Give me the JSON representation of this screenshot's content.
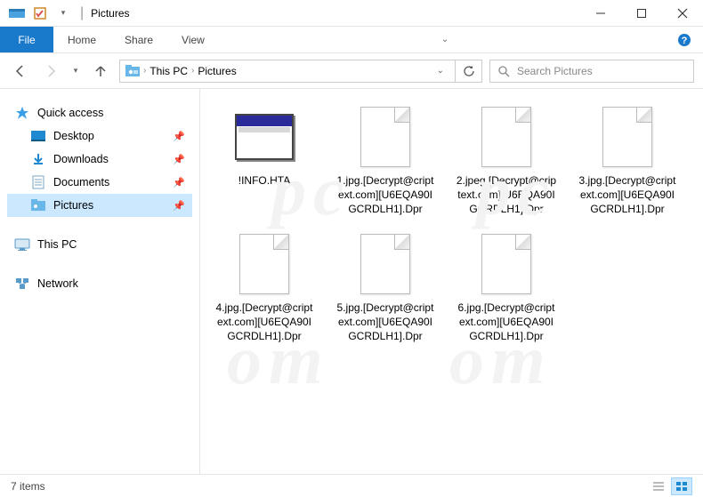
{
  "window": {
    "title": "Pictures"
  },
  "ribbon": {
    "file": "File",
    "tabs": [
      "Home",
      "Share",
      "View"
    ]
  },
  "breadcrumb": {
    "segments": [
      "This PC",
      "Pictures"
    ]
  },
  "search": {
    "placeholder": "Search Pictures"
  },
  "sidebar": {
    "quick_access": "Quick access",
    "items": [
      {
        "label": "Desktop",
        "icon": "desktop"
      },
      {
        "label": "Downloads",
        "icon": "downloads"
      },
      {
        "label": "Documents",
        "icon": "documents"
      },
      {
        "label": "Pictures",
        "icon": "pictures",
        "selected": true
      }
    ],
    "this_pc": "This PC",
    "network": "Network"
  },
  "files": [
    {
      "name": "!INFO.HTA",
      "icon": "hta"
    },
    {
      "name": "1.jpg.[Decrypt@criptext.com][U6EQA90IGCRDLH1].Dpr",
      "icon": "blank"
    },
    {
      "name": "2.jpeg.[Decrypt@criptext.com][U6EQA90IGCRDLH1].Dpr",
      "icon": "blank"
    },
    {
      "name": "3.jpg.[Decrypt@criptext.com][U6EQA90IGCRDLH1].Dpr",
      "icon": "blank"
    },
    {
      "name": "4.jpg.[Decrypt@criptext.com][U6EQA90IGCRDLH1].Dpr",
      "icon": "blank"
    },
    {
      "name": "5.jpg.[Decrypt@criptext.com][U6EQA90IGCRDLH1].Dpr",
      "icon": "blank"
    },
    {
      "name": "6.jpg.[Decrypt@criptext.com][U6EQA90IGCRDLH1].Dpr",
      "icon": "blank"
    }
  ],
  "status": {
    "count_text": "7 items"
  }
}
